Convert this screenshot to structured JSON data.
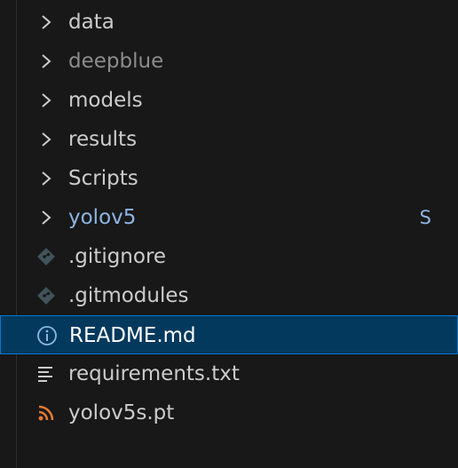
{
  "explorer": {
    "items": [
      {
        "type": "folder",
        "label": "data",
        "icon": "chevron-right-icon"
      },
      {
        "type": "folder",
        "label": "deepblue",
        "icon": "chevron-right-icon",
        "state": "ignored"
      },
      {
        "type": "folder",
        "label": "models",
        "icon": "chevron-right-icon"
      },
      {
        "type": "folder",
        "label": "results",
        "icon": "chevron-right-icon"
      },
      {
        "type": "folder",
        "label": "Scripts",
        "icon": "chevron-right-icon"
      },
      {
        "type": "folder",
        "label": "yolov5",
        "icon": "chevron-right-icon",
        "state": "submodule",
        "badge": "S"
      },
      {
        "type": "file",
        "label": ".gitignore",
        "icon": "git-diamond-icon"
      },
      {
        "type": "file",
        "label": ".gitmodules",
        "icon": "git-diamond-icon"
      },
      {
        "type": "file",
        "label": "README.md",
        "icon": "info-icon",
        "selected": true
      },
      {
        "type": "file",
        "label": "requirements.txt",
        "icon": "text-lines-icon"
      },
      {
        "type": "file",
        "label": "yolov5s.pt",
        "icon": "rss-feed-icon"
      }
    ]
  },
  "colors": {
    "background": "#181818",
    "text": "#cccccc",
    "ignored_text": "#8c8c8c",
    "submodule_text": "#8db5e2",
    "selection_bg": "#04395e",
    "selection_border": "#0078d4",
    "rss_icon": "#e37933"
  }
}
